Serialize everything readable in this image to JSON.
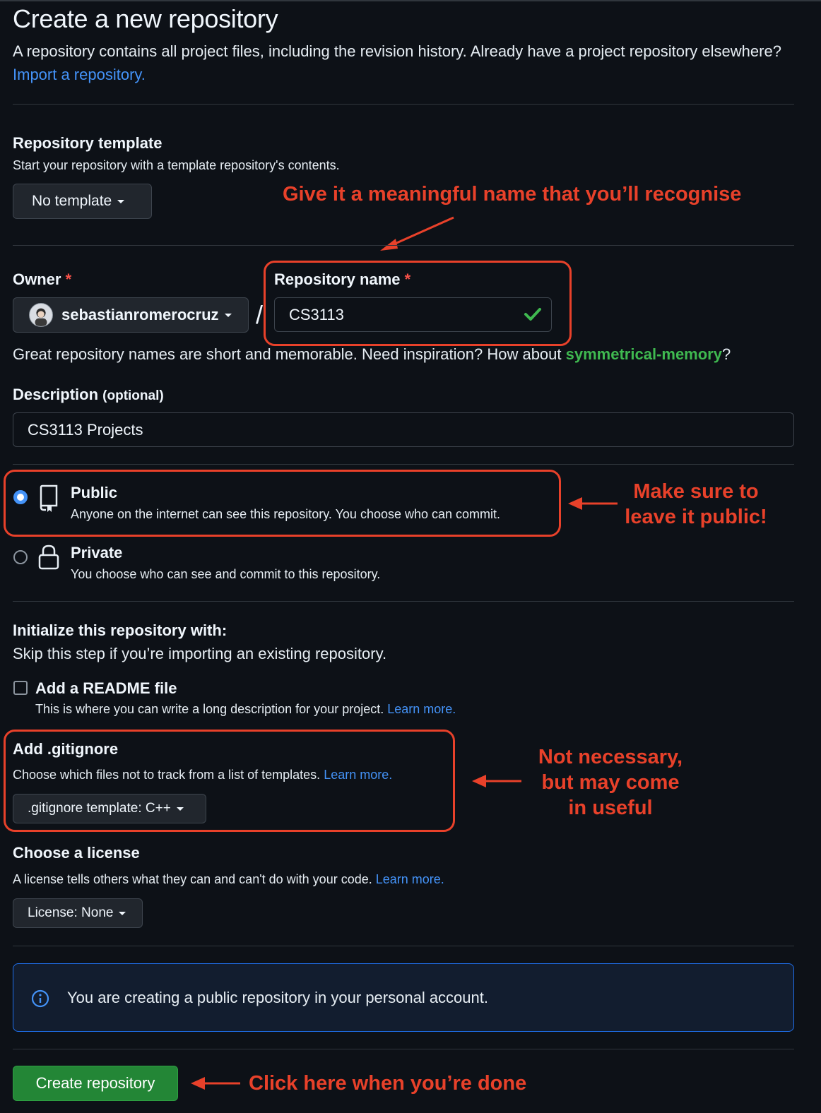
{
  "header": {
    "title": "Create a new repository",
    "lead_text": "A repository contains all project files, including the revision history. Already have a project repository elsewhere?",
    "import_link": "Import a repository."
  },
  "template": {
    "label": "Repository template",
    "sub": "Start your repository with a template repository's contents.",
    "button": "No template"
  },
  "owner": {
    "label": "Owner",
    "required_mark": "*",
    "value": "sebastianromerocruz",
    "separator": "/"
  },
  "repo_name": {
    "label": "Repository name",
    "required_mark": "*",
    "value": "CS3113",
    "hint_prefix": "Great repository names are short and memorable. Need inspiration? How about",
    "suggestion": "symmetrical-memory",
    "hint_suffix": "?"
  },
  "description": {
    "label": "Description",
    "optional": "(optional)",
    "value": "CS3113 Projects"
  },
  "visibility": {
    "public": {
      "label": "Public",
      "sub": "Anyone on the internet can see this repository. You choose who can commit.",
      "selected": true
    },
    "private": {
      "label": "Private",
      "sub": "You choose who can see and commit to this repository.",
      "selected": false
    }
  },
  "initialize": {
    "label": "Initialize this repository with:",
    "sub": "Skip this step if you’re importing an existing repository.",
    "readme": {
      "label": "Add a README file",
      "sub": "This is where you can write a long description for your project.",
      "learn": "Learn more.",
      "checked": false
    }
  },
  "gitignore": {
    "label": "Add .gitignore",
    "sub": "Choose which files not to track from a list of templates.",
    "learn": "Learn more.",
    "button": ".gitignore template: C++"
  },
  "license": {
    "label": "Choose a license",
    "sub": "A license tells others what they can and can't do with your code.",
    "learn": "Learn more.",
    "button": "License: None"
  },
  "info_banner": "You are creating a public repository in your personal account.",
  "create_button": "Create repository",
  "annotations": {
    "name_hint": "Give it a meaningful name that you’ll recognise",
    "public_hint_line1": "Make sure to",
    "public_hint_line2": "leave it public!",
    "gitignore_hint_line1": "Not necessary,",
    "gitignore_hint_line2": "but may come",
    "gitignore_hint_line3": "in useful",
    "create_hint": "Click here when you’re done"
  },
  "colors": {
    "accent": "#4493f8",
    "annotation": "#e8412a",
    "success": "#3fb950",
    "create": "#238636"
  }
}
